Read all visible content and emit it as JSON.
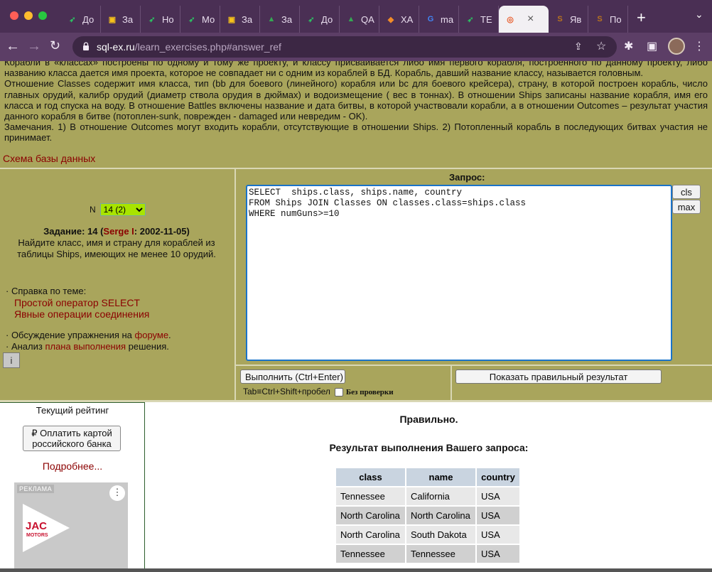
{
  "browser": {
    "tabs": [
      {
        "icon_name": "stepik-icon",
        "icon_color": "#2cbf62",
        "title": "До"
      },
      {
        "icon_name": "classroom-icon",
        "icon_color": "#f7c21a",
        "title": "За"
      },
      {
        "icon_name": "stepik-icon",
        "icon_color": "#2cbf62",
        "title": "Но"
      },
      {
        "icon_name": "stepik-icon",
        "icon_color": "#2cbf62",
        "title": "Мо"
      },
      {
        "icon_name": "classroom-icon",
        "icon_color": "#f7c21a",
        "title": "За"
      },
      {
        "icon_name": "drive-icon",
        "icon_color": "#34a853",
        "title": "За"
      },
      {
        "icon_name": "stepik-icon",
        "icon_color": "#2cbf62",
        "title": "До"
      },
      {
        "icon_name": "drive-icon",
        "icon_color": "#34a853",
        "title": "QA"
      },
      {
        "icon_name": "xai-icon",
        "icon_color": "#f28c28",
        "title": "ХА"
      },
      {
        "icon_name": "google-icon",
        "icon_color": "#4285f4",
        "title": "ma"
      },
      {
        "icon_name": "stepik-icon",
        "icon_color": "#2cbf62",
        "title": "TE"
      },
      {
        "icon_name": "target-icon",
        "icon_color": "#e85c2b",
        "title": "",
        "active": true
      },
      {
        "icon_name": "sqlex-icon",
        "icon_color": "#b8731f",
        "title": "Яв"
      },
      {
        "icon_name": "sqlex-icon",
        "icon_color": "#b8731f",
        "title": "По"
      }
    ],
    "url_host": "sql-ex.ru",
    "url_path": "/learn_exercises.php#answer_ref"
  },
  "description": {
    "lines": [
      "Корабли в «классах» построены по одному и тому же проекту, и классу присваивается либо имя первого корабля, построенного по данному проекту, либо названию класса дается имя проекта, которое не совпадает ни с одним из кораблей в БД. Корабль, давший название классу, называется головным.",
      "Отношение Classes содержит имя класса, тип (bb для боевого (линейного) корабля или bc для боевого крейсера), страну, в которой построен корабль, число главных орудий, калибр орудий (диаметр ствола орудия в дюймах) и водоизмещение ( вес в тоннах). В отношении Ships записаны название корабля, имя его класса и год спуска на воду. В отношение Battles включены название и дата битвы, в которой участвовали корабли, а в отношении Outcomes – результат участия данного корабля в битве (потоплен-sunk, поврежден - damaged или невредим - OK).",
      "Замечания. 1) В отношение Outcomes могут входить корабли, отсутствующие в отношении Ships. 2) Потопленный корабль в последующих битвах участия не принимает."
    ],
    "schema_link": "Схема базы данных"
  },
  "exercise": {
    "n_label": "N",
    "selected": "14 (2)",
    "task_prefix": "Задание: 14 (",
    "author": "Serge I",
    "task_suffix": ": 2002-11-05)",
    "task_text": "Найдите класс, имя и страну для кораблей из таблицы Ships, имеющих не менее 10 орудий."
  },
  "help": {
    "title": "· Справка по теме:",
    "links": [
      "Простой оператор SELECT",
      "Явные операции соединения"
    ],
    "discussion_prefix": "· Обсуждение упражнения на ",
    "discussion_link": "форуме",
    "discussion_suffix": ".",
    "plan_prefix": "· Анализ ",
    "plan_link": "плана выполнения",
    "plan_suffix": " решения.",
    "info_icon": "i"
  },
  "query": {
    "title": "Запрос:",
    "text": "SELECT  ships.class, ships.name, country\nFROM Ships JOIN Classes ON classes.class=ships.class\nWHERE numGuns>=10",
    "cls_label": "cls",
    "max_label": "max",
    "run_label": "Выполнить (Ctrl+Enter)",
    "tab_hint": "Tab≡Ctrl+Shift+пробел",
    "nocheck_label": "Без проверки",
    "show_result_label": "Показать правильный результат"
  },
  "rating": {
    "title": "Текущий рейтинг",
    "pay_button": "₽ Оплатить картой российского банка",
    "more_link": "Подробнее...",
    "ad_label": "РЕКЛАМА",
    "ad_brand": "JAC",
    "ad_brand_sub": "MOTORS"
  },
  "result": {
    "status": "Правильно.",
    "title": "Результат выполнения Вашего запроса:",
    "columns": [
      "class",
      "name",
      "country"
    ],
    "rows": [
      [
        "Tennessee",
        "California",
        "USA"
      ],
      [
        "North Carolina",
        "North Carolina",
        "USA"
      ],
      [
        "North Carolina",
        "South Dakota",
        "USA"
      ],
      [
        "Tennessee",
        "Tennessee",
        "USA"
      ]
    ]
  }
}
